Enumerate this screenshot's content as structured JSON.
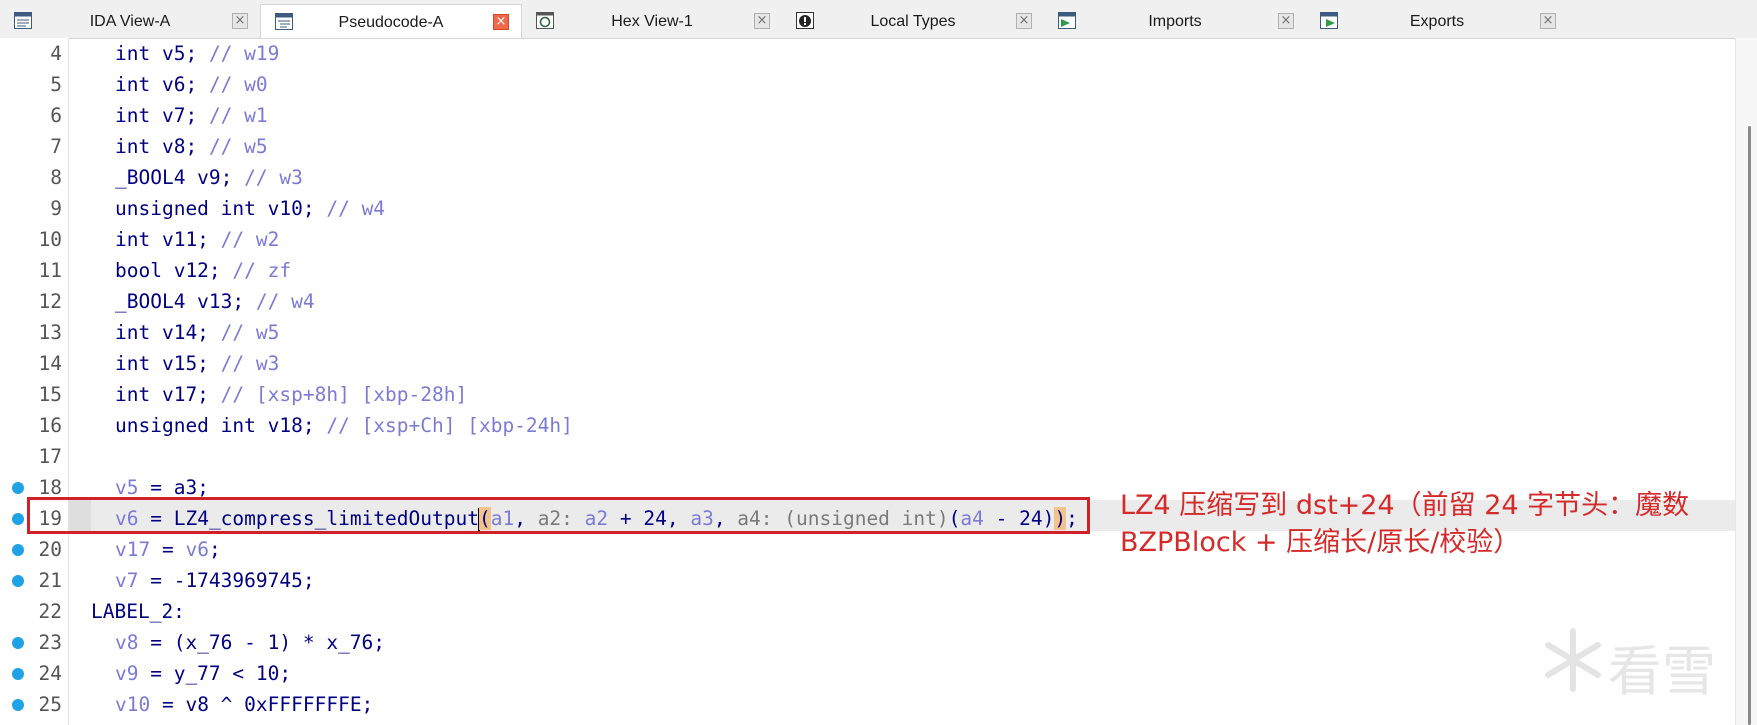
{
  "tabs": [
    {
      "label": "IDA View-A",
      "icon": "ida-view-icon",
      "active": false
    },
    {
      "label": "Pseudocode-A",
      "icon": "pseudocode-icon",
      "active": true
    },
    {
      "label": "Hex View-1",
      "icon": "hex-view-icon",
      "active": false
    },
    {
      "label": "Local Types",
      "icon": "local-types-icon",
      "active": false
    },
    {
      "label": "Imports",
      "icon": "imports-icon",
      "active": false
    },
    {
      "label": "Exports",
      "icon": "exports-icon",
      "active": false
    }
  ],
  "close_glyph": "×",
  "lines": [
    {
      "num": "4",
      "dot": false
    },
    {
      "num": "5",
      "dot": false
    },
    {
      "num": "6",
      "dot": false
    },
    {
      "num": "7",
      "dot": false
    },
    {
      "num": "8",
      "dot": false
    },
    {
      "num": "9",
      "dot": false
    },
    {
      "num": "10",
      "dot": false
    },
    {
      "num": "11",
      "dot": false
    },
    {
      "num": "12",
      "dot": false
    },
    {
      "num": "13",
      "dot": false
    },
    {
      "num": "14",
      "dot": false
    },
    {
      "num": "15",
      "dot": false
    },
    {
      "num": "16",
      "dot": false
    },
    {
      "num": "17",
      "dot": false
    },
    {
      "num": "18",
      "dot": true
    },
    {
      "num": "19",
      "dot": true
    },
    {
      "num": "20",
      "dot": true
    },
    {
      "num": "21",
      "dot": true
    },
    {
      "num": "22",
      "dot": false
    },
    {
      "num": "23",
      "dot": true
    },
    {
      "num": "24",
      "dot": true
    },
    {
      "num": "25",
      "dot": true
    }
  ],
  "code": {
    "l4": {
      "decl": "int v5;",
      "comment": "// w19"
    },
    "l5": {
      "decl": "int v6;",
      "comment": "// w0"
    },
    "l6": {
      "decl": "int v7;",
      "comment": "// w1"
    },
    "l7": {
      "decl": "int v8;",
      "comment": "// w5"
    },
    "l8": {
      "decl": "_BOOL4 v9;",
      "comment": "// w3"
    },
    "l9": {
      "decl": "unsigned int v10;",
      "comment": "// w4"
    },
    "l10": {
      "decl": "int v11;",
      "comment": "// w2"
    },
    "l11": {
      "decl": "bool v12;",
      "comment": "// zf"
    },
    "l12": {
      "decl": "_BOOL4 v13;",
      "comment": "// w4"
    },
    "l13": {
      "decl": "int v14;",
      "comment": "// w5"
    },
    "l14": {
      "decl": "int v15;",
      "comment": "// w3"
    },
    "l15": {
      "decl": "int v17;",
      "comment": "// [xsp+8h] [xbp-28h]"
    },
    "l16": {
      "decl": "unsigned int v18;",
      "comment": "// [xsp+Ch] [xbp-24h]"
    },
    "l18": {
      "lhs": "v5",
      "rest": " = a3;"
    },
    "l19": {
      "lhs": "v6",
      "eq": " = ",
      "func": "LZ4_compress_limitedOutput",
      "open": "(",
      "a1": "a1",
      "sep1": ", ",
      "h2": "a2: ",
      "a2": "a2",
      "plus": " + 24, ",
      "a3": "a3",
      "sep3": ", ",
      "h4": "a4: ",
      "cast": "(unsigned int)",
      "paren4": "(",
      "a4": "a4",
      "minus": " - 24)",
      "close": ")",
      "semi": ";"
    },
    "l20": {
      "lhs": "v17",
      "eq": " = ",
      "rhs": "v6",
      "semi": ";"
    },
    "l21": {
      "lhs": "v7",
      "rest": " = -1743969745;"
    },
    "l22": {
      "label": "LABEL_2:"
    },
    "l23": {
      "lhs": "v8",
      "rest": " = (x_76 - 1) * x_76;"
    },
    "l24": {
      "lhs": "v9",
      "rest": " = y_77 < 10;"
    },
    "l25": {
      "lhs": "v10",
      "rest": " = v8 ^ 0xFFFFFFFE;"
    }
  },
  "annotation": {
    "line1": "LZ4 压缩写到 dst+24（前留 24 字节头：魔数",
    "line2": "BZPBlock + 压缩长/原长/校验）"
  },
  "watermark": "看雪",
  "colors": {
    "keyword": "#000080",
    "comment": "#7b7bd6",
    "annotation": "#d42a2a",
    "dot": "#1fa2e6",
    "box": "#d0202a"
  }
}
